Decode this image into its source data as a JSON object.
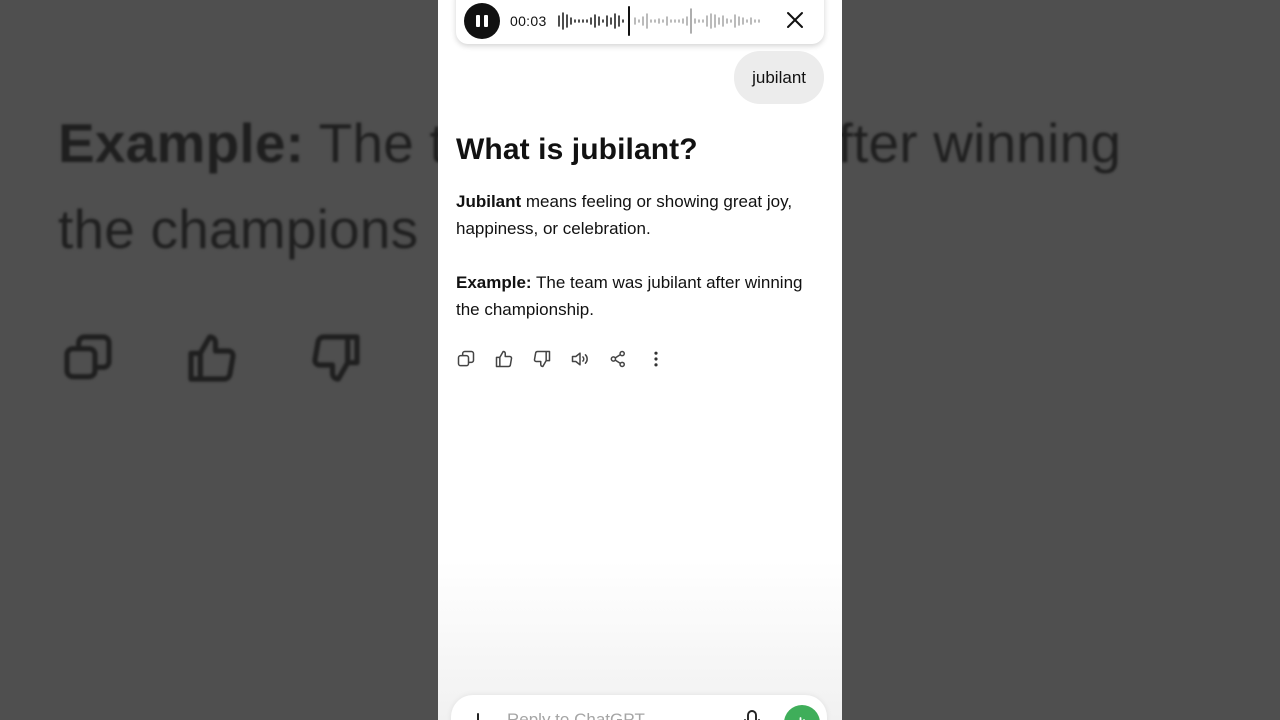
{
  "background": {
    "example_label": "Example:",
    "example_text": " The t",
    "example_text_tail": "nt after winning",
    "line2": "the champions"
  },
  "voice_recording": {
    "elapsed": "00:03",
    "pause_icon": "pause-icon",
    "close_icon": "close-icon"
  },
  "conversation": {
    "user_message": "jubilant",
    "assistant": {
      "heading": "What is jubilant?",
      "definition_term": "Jubilant",
      "definition_rest": " means feeling or showing great joy, happiness, or celebration.",
      "example_label": "Example:",
      "example_text": " The team was jubilant after winning the championship."
    },
    "actions": [
      "copy-icon",
      "thumbs-up-icon",
      "thumbs-down-icon",
      "read-aloud-icon",
      "share-icon",
      "more-options-icon"
    ]
  },
  "composer": {
    "placeholder": "Reply to ChatGPT",
    "accent_color": "#3fae5a"
  }
}
